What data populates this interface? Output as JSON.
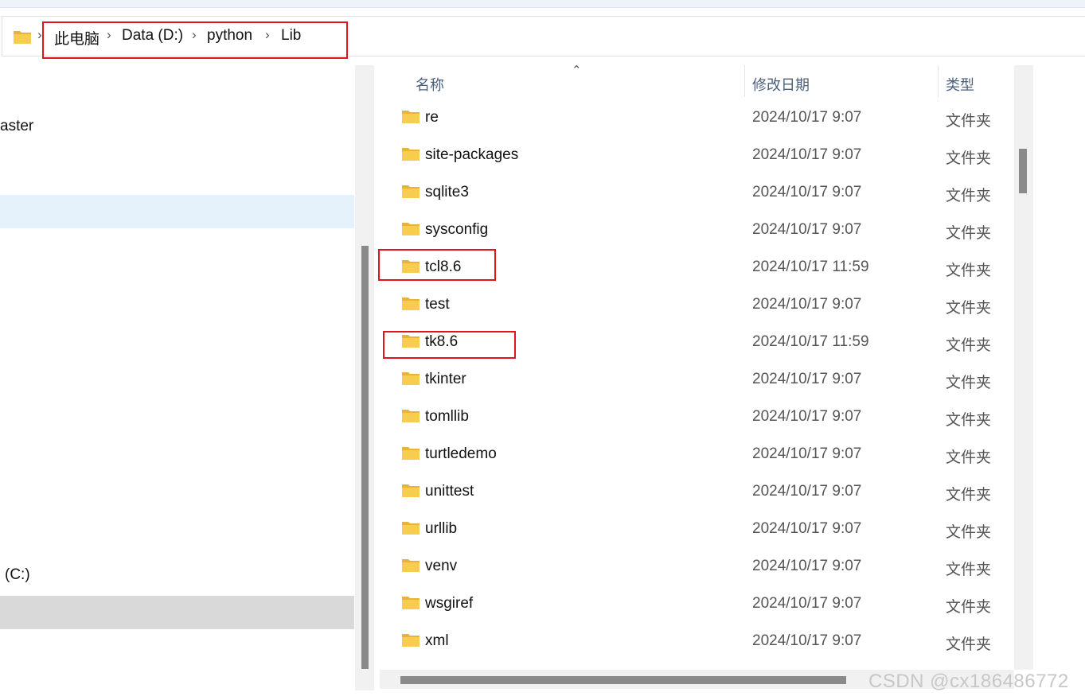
{
  "breadcrumb": {
    "items": [
      "此电脑",
      "Data (D:)",
      "python",
      "Lib"
    ]
  },
  "nav": {
    "item_partial": "aster",
    "drive_partial": "(C:)"
  },
  "columns": {
    "name": "名称",
    "date": "修改日期",
    "type": "类型"
  },
  "files": [
    {
      "name": "re",
      "date": "2024/10/17 9:07",
      "type": "文件夹"
    },
    {
      "name": "site-packages",
      "date": "2024/10/17 9:07",
      "type": "文件夹"
    },
    {
      "name": "sqlite3",
      "date": "2024/10/17 9:07",
      "type": "文件夹"
    },
    {
      "name": "sysconfig",
      "date": "2024/10/17 9:07",
      "type": "文件夹"
    },
    {
      "name": "tcl8.6",
      "date": "2024/10/17 11:59",
      "type": "文件夹"
    },
    {
      "name": "test",
      "date": "2024/10/17 9:07",
      "type": "文件夹"
    },
    {
      "name": "tk8.6",
      "date": "2024/10/17 11:59",
      "type": "文件夹"
    },
    {
      "name": "tkinter",
      "date": "2024/10/17 9:07",
      "type": "文件夹"
    },
    {
      "name": "tomllib",
      "date": "2024/10/17 9:07",
      "type": "文件夹"
    },
    {
      "name": "turtledemo",
      "date": "2024/10/17 9:07",
      "type": "文件夹"
    },
    {
      "name": "unittest",
      "date": "2024/10/17 9:07",
      "type": "文件夹"
    },
    {
      "name": "urllib",
      "date": "2024/10/17 9:07",
      "type": "文件夹"
    },
    {
      "name": "venv",
      "date": "2024/10/17 9:07",
      "type": "文件夹"
    },
    {
      "name": "wsgiref",
      "date": "2024/10/17 9:07",
      "type": "文件夹"
    },
    {
      "name": "xml",
      "date": "2024/10/17 9:07",
      "type": "文件夹"
    }
  ],
  "watermark": "CSDN @cx186486772",
  "colors": {
    "highlight_box": "#e0141b",
    "folder_icon": "#f8cc4e",
    "nav_hover": "#e5f1fb",
    "nav_selected": "#d9d9d9"
  }
}
